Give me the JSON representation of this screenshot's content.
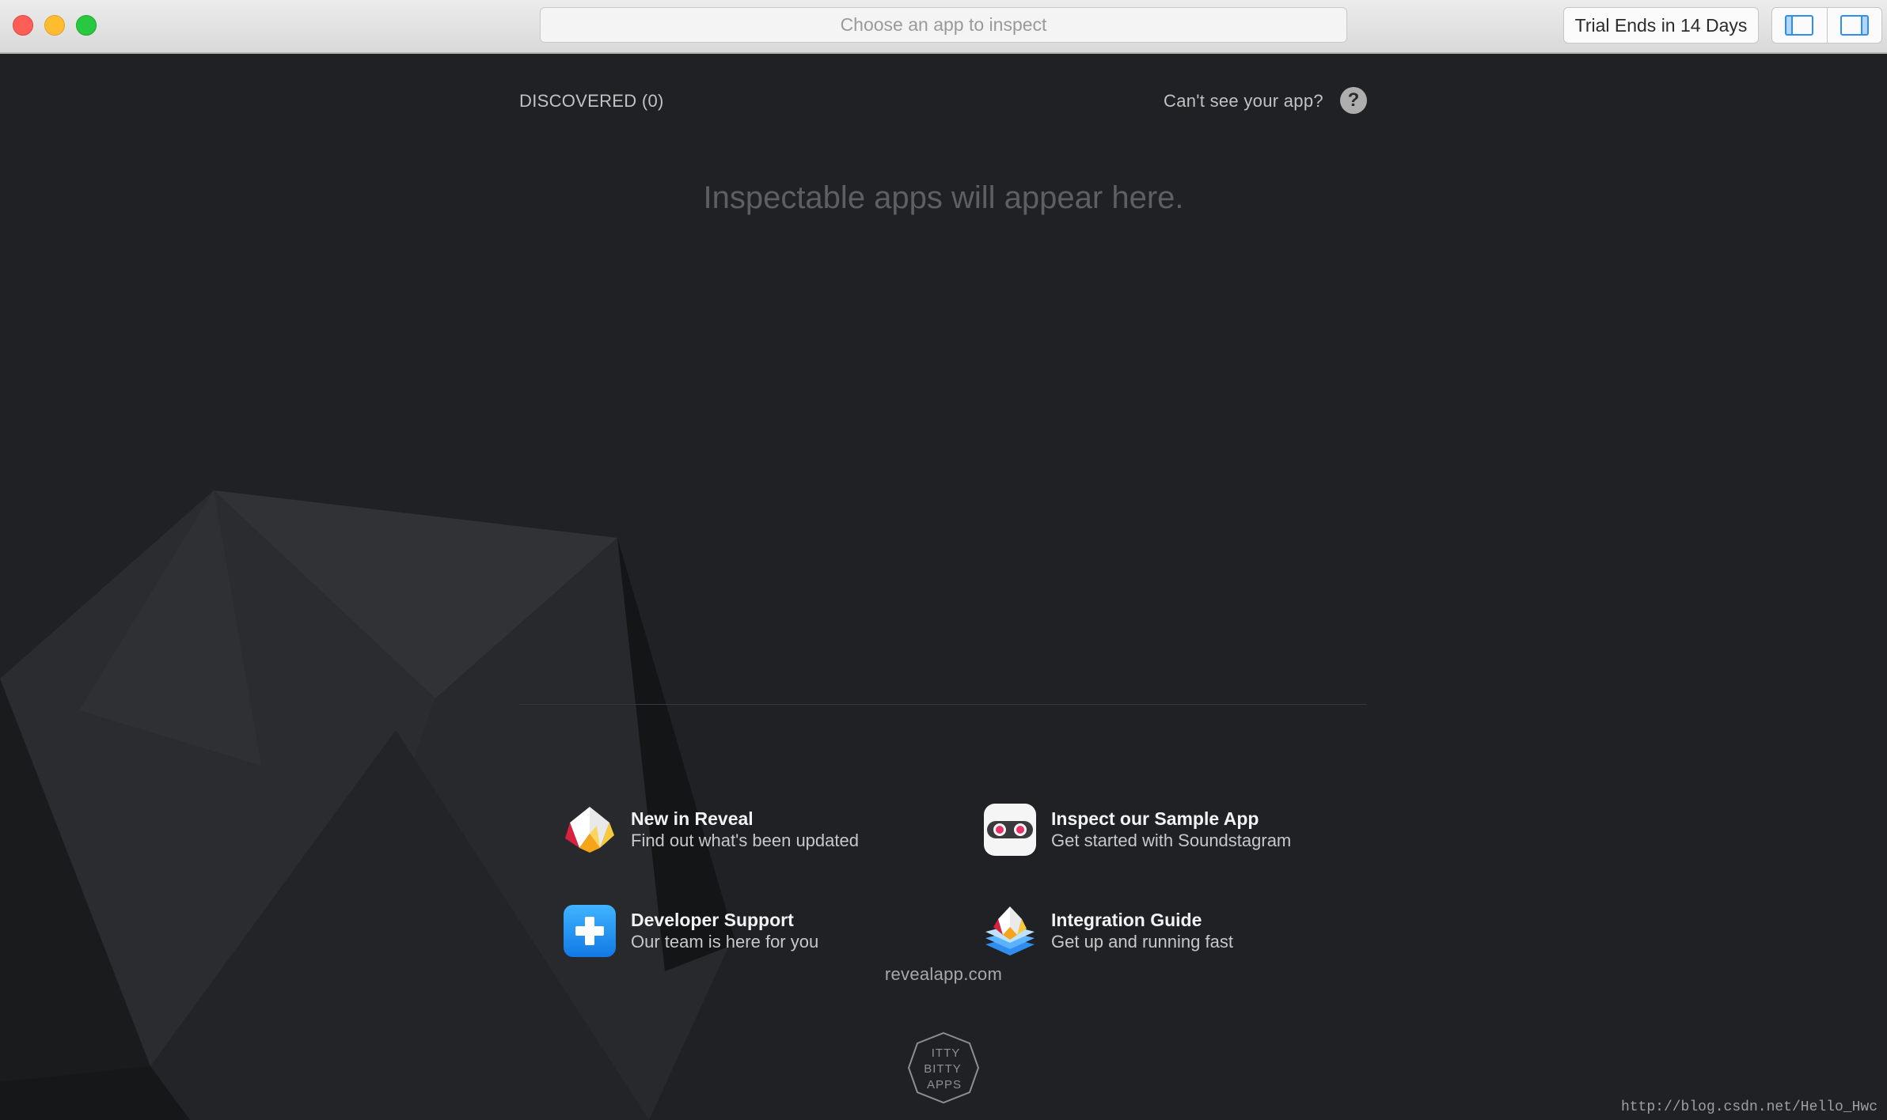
{
  "titlebar": {
    "app_chooser_placeholder": "Choose an app to inspect",
    "trial_label": "Trial Ends in 14 Days"
  },
  "discovered": {
    "heading": "DISCOVERED (0)",
    "help_text": "Can't see your app?",
    "help_icon_glyph": "?",
    "empty_message": "Inspectable apps will appear here."
  },
  "links": [
    {
      "title": "New in Reveal",
      "subtitle": "Find out what's been updated",
      "icon": "reveal-logo-icon"
    },
    {
      "title": "Inspect our Sample App",
      "subtitle": "Get started with Soundstagram",
      "icon": "soundstagram-icon"
    },
    {
      "title": "Developer Support",
      "subtitle": "Our team is here for you",
      "icon": "plus-icon"
    },
    {
      "title": "Integration Guide",
      "subtitle": "Get up and running fast",
      "icon": "layers-icon"
    }
  ],
  "footer": {
    "site": "revealapp.com",
    "logo_text": "ITTY BITTY APPS"
  },
  "watermark": "http://blog.csdn.net/Hello_Hwc",
  "colors": {
    "background": "#1f2124",
    "traffic_close": "#fd5f57",
    "traffic_min": "#febc2e",
    "traffic_max": "#28c840",
    "accent_blue": "#2f8ef0"
  }
}
